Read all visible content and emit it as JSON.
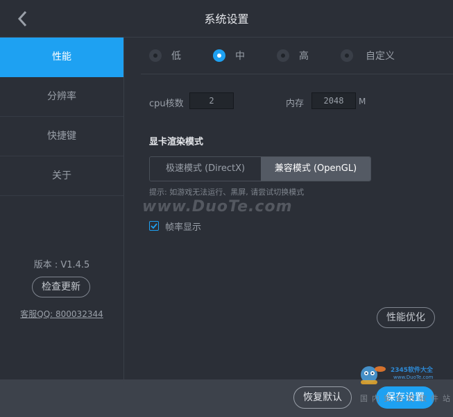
{
  "header": {
    "title": "系统设置"
  },
  "sidebar": {
    "items": [
      {
        "label": "性能",
        "active": true
      },
      {
        "label": "分辨率",
        "active": false
      },
      {
        "label": "快捷键",
        "active": false
      },
      {
        "label": "关于",
        "active": false
      }
    ],
    "version": "版本 : V1.4.5",
    "check_update": "检查更新",
    "service": "客服QQ: 800032344"
  },
  "performance": {
    "levels": [
      {
        "label": "低",
        "selected": false
      },
      {
        "label": "中",
        "selected": true
      },
      {
        "label": "高",
        "selected": false
      },
      {
        "label": "自定义",
        "selected": false
      }
    ],
    "cpu_label": "cpu核数",
    "cpu_value": "2",
    "memory_label": "内存",
    "memory_value": "2048",
    "memory_unit": "M",
    "render_title": "显卡渲染模式",
    "render_modes": [
      {
        "label": "极速模式 (DirectX)",
        "selected": false
      },
      {
        "label": "兼容模式 (OpenGL)",
        "selected": true
      }
    ],
    "hint": "提示: 如游戏无法运行、黑屏, 请尝试切换模式",
    "fps_label": "帧率显示",
    "fps_checked": true,
    "optimize": "性能优化"
  },
  "watermark": "www.DuoTe.com",
  "logo": {
    "text": "2345软件大全",
    "url": "www.DuoTe.com",
    "cn": "国内安全的软件站"
  },
  "footer": {
    "reset": "恢复默认",
    "save": "保存设置"
  },
  "colors": {
    "accent": "#1ea1f2",
    "background": "#2b2f37",
    "footer": "#3d424b"
  }
}
